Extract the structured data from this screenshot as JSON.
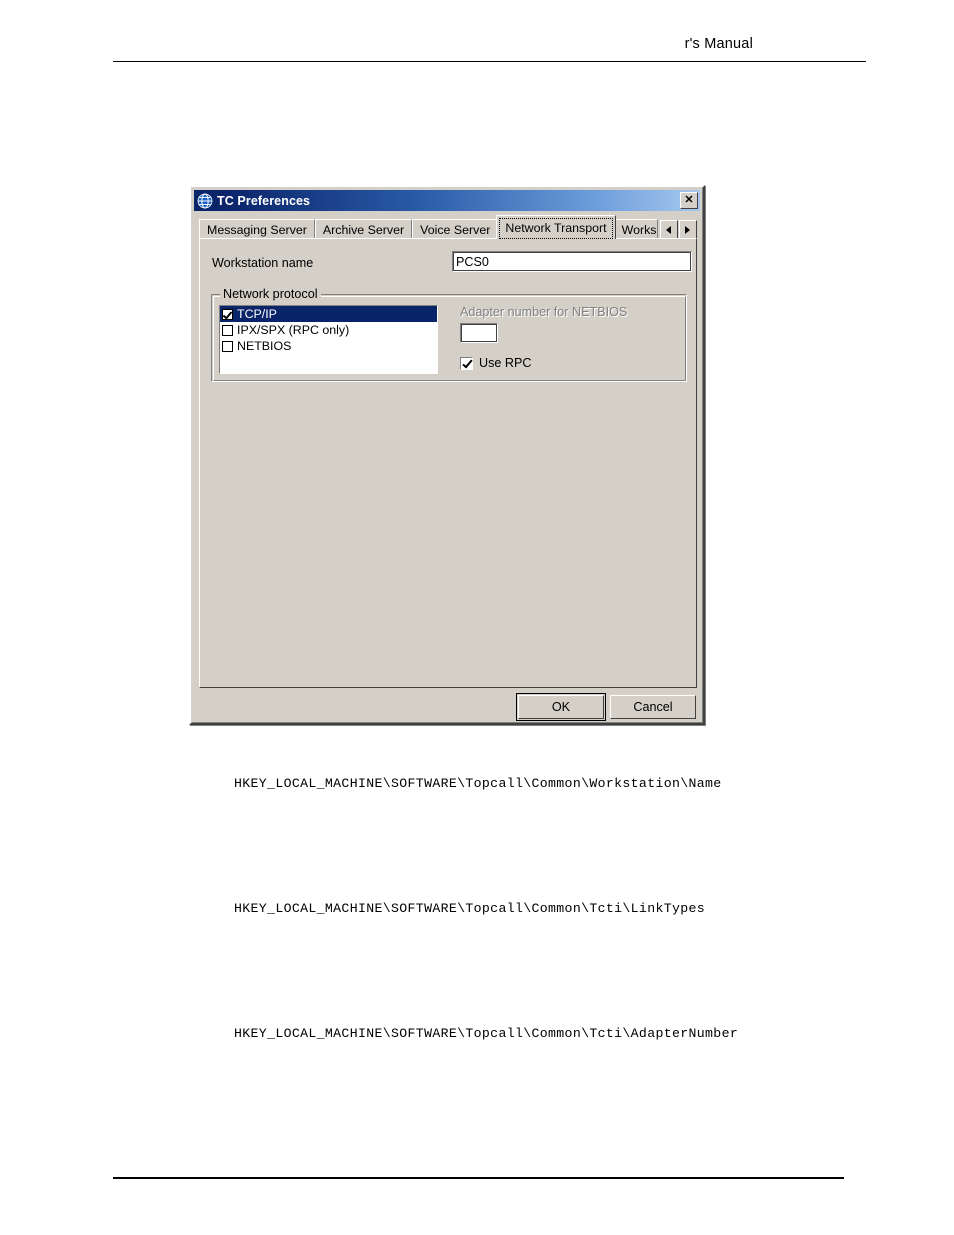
{
  "page": {
    "header_text": "r's Manual",
    "registry_paths": [
      "HKEY_LOCAL_MACHINE\\SOFTWARE\\Topcall\\Common\\Workstation\\Name",
      "HKEY_LOCAL_MACHINE\\SOFTWARE\\Topcall\\Common\\Tcti\\LinkTypes",
      "HKEY_LOCAL_MACHINE\\SOFTWARE\\Topcall\\Common\\Tcti\\AdapterNumber"
    ]
  },
  "dialog": {
    "title": "TC Preferences",
    "title_icon": "globe-icon",
    "close_label": "✕",
    "colors": {
      "titlebar_start": "#0a246a",
      "titlebar_end": "#a6c8ee",
      "face": "#d4d0c8",
      "selection": "#0a246a",
      "disabled_text": "#808080"
    },
    "tabs": [
      {
        "label": "Messaging Server",
        "selected": false
      },
      {
        "label": "Archive Server",
        "selected": false
      },
      {
        "label": "Voice Server",
        "selected": false
      },
      {
        "label": "Network Transport",
        "selected": true
      },
      {
        "label": "Works",
        "selected": false,
        "truncated": true
      }
    ],
    "tab_scroll": {
      "left_label": "◄",
      "right_label": "►"
    },
    "page": {
      "workstation": {
        "label": "Workstation name",
        "value": "PCS0",
        "placeholder": ""
      },
      "network_protocol": {
        "title": "Network protocol",
        "items": [
          {
            "label": "TCP/IP",
            "checked": true,
            "selected": true
          },
          {
            "label": "IPX/SPX (RPC only)",
            "checked": false,
            "selected": false
          },
          {
            "label": "NETBIOS",
            "checked": false,
            "selected": false
          }
        ],
        "adapter": {
          "label": "Adapter number for NETBIOS",
          "disabled": true,
          "value": "",
          "placeholder": ""
        },
        "use_rpc": {
          "label": "Use RPC",
          "checked": true
        }
      }
    },
    "buttons": {
      "ok": "OK",
      "cancel": "Cancel"
    }
  }
}
